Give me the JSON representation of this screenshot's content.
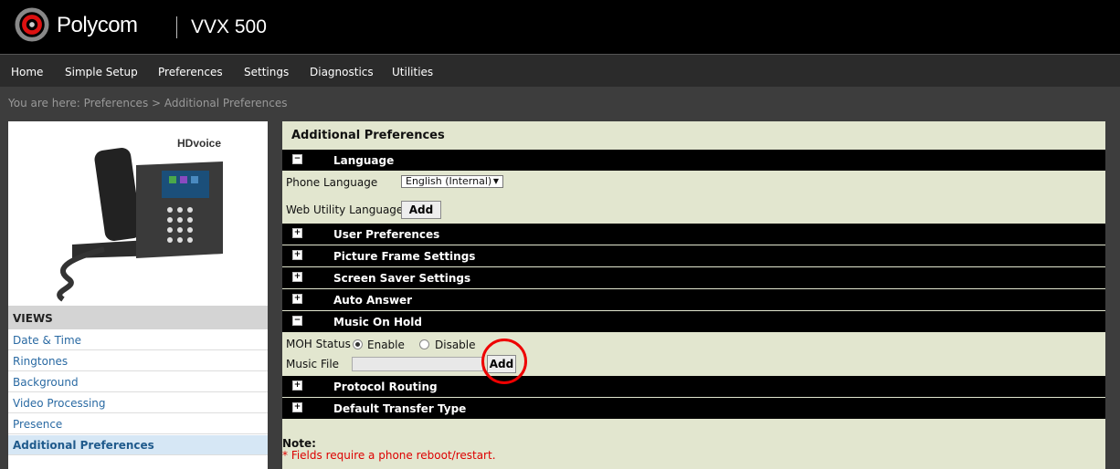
{
  "header": {
    "brand": "Polycom",
    "model": "VVX 500"
  },
  "nav": [
    "Home",
    "Simple Setup",
    "Preferences",
    "Settings",
    "Diagnostics",
    "Utilities"
  ],
  "breadcrumb": "You are here: Preferences > Additional Preferences",
  "phone_image": {
    "badge": "HDvoice"
  },
  "views": {
    "heading": "VIEWS",
    "items": [
      "Date & Time",
      "Ringtones",
      "Background",
      "Video Processing",
      "Presence",
      "Additional Preferences"
    ],
    "active": "Additional Preferences"
  },
  "main": {
    "title": "Additional Preferences",
    "sections": {
      "language": "Language",
      "user_prefs": "User Preferences",
      "picture_frame": "Picture Frame Settings",
      "screen_saver": "Screen Saver Settings",
      "auto_answer": "Auto Answer",
      "music_on_hold": "Music On Hold",
      "protocol_routing": "Protocol Routing",
      "default_transfer": "Default Transfer Type"
    },
    "phone_language_label": "Phone Language",
    "phone_language_value": "English (Internal)",
    "web_utility_language_label": "Web Utility Language",
    "add_label": "Add",
    "moh_status_label": "MOH Status",
    "enable_label": "Enable",
    "disable_label": "Disable",
    "moh_status_value": "Enable",
    "music_file_label": "Music File",
    "note_label": "Note:",
    "note_text": "* Fields require a phone reboot/restart."
  },
  "colors": {
    "annotation_circle": "#e00000",
    "panel_bg": "#e2e6cf",
    "active_view_bg": "#d6e7f5"
  }
}
